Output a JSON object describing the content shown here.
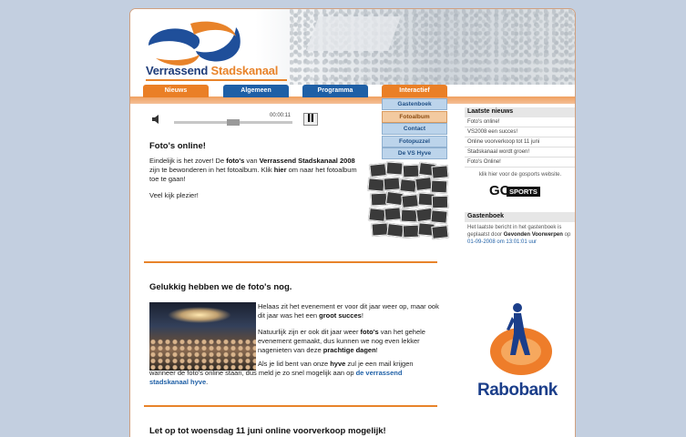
{
  "header": {
    "logo_part1": "Verrassend",
    "logo_part2": "Stadskanaal"
  },
  "nav": {
    "tabs": [
      {
        "label": "Nieuws"
      },
      {
        "label": "Algemeen"
      },
      {
        "label": "Programma"
      },
      {
        "label": "Interactief"
      }
    ],
    "submenu": [
      {
        "label": "Gastenboek"
      },
      {
        "label": "Fotoalbum"
      },
      {
        "label": "Contact"
      },
      {
        "label": "Fotopuzzel"
      },
      {
        "label": "De VS Hyve"
      }
    ]
  },
  "player": {
    "time": "00:00:11",
    "speaker_icon": "speaker-icon",
    "pause_icon": "pause-icon"
  },
  "articles": [
    {
      "title": "Foto's online!",
      "p1_a": "Eindelijk is het zover! De ",
      "p1_b": "foto's",
      "p1_c": " van ",
      "p1_d": "Verrassend Stadskanaal 2008",
      "p1_e": " zijn te bewonderen in het fotoalbum. Klik ",
      "p1_f": "hier",
      "p1_g": " om naar het fotoalbum toe te gaan!",
      "p2": "Veel kijk plezier!"
    },
    {
      "title": "Gelukkig hebben we de foto's nog.",
      "p1_a": "Helaas zit het evenement er voor dit jaar weer op, maar ook dit jaar was het een ",
      "p1_b": "groot succes",
      "p1_c": "!",
      "p2_a": "Natuurlijk zijn er ook dit jaar weer ",
      "p2_b": "foto's",
      "p2_c": " van het gehele evenement gemaakt, dus kunnen we nog even lekker nagenieten van deze ",
      "p2_d": "prachtige dagen",
      "p2_e": "!",
      "p3_a": "Als je lid bent van onze ",
      "p3_b": "hyve",
      "p3_c": " zul je een mail krijgen wanneer de foto's online staan, dus meld je zo snel mogelijk aan op ",
      "p3_d": "de verrassend stadskanaal hyve",
      "p3_e": "."
    },
    {
      "title": "Let op tot woensdag 11 juni online voorverkoop mogelijk!"
    }
  ],
  "sidebar": {
    "news_title": "Laatste nieuws",
    "news_items": [
      "Foto's online!",
      "VS2008 een succes!",
      "Online voorverkoop tot 11 juni",
      "Stadskanaal wordt groen!",
      "Foto's Online!"
    ],
    "go_text": "klik hier voor de gosports website.",
    "go_logo_a": "GO",
    "go_logo_b": "SPORTS",
    "guestbook_title": "Gastenboek",
    "gb_a": "Het laatste bericht in het gastenboek is geplaatst door ",
    "gb_b": "Gevonden Voorwerpen",
    "gb_c": " op ",
    "gb_d": "01-09-2008 om 13:01:01 uur",
    "sponsor": "Rabobank"
  }
}
